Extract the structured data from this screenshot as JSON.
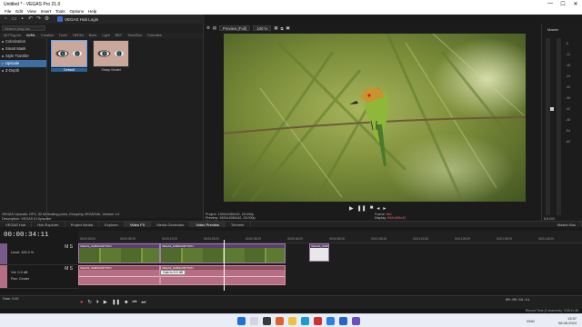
{
  "window": {
    "title": "Untitled * - VEGAS Pro 21.0",
    "controls": [
      "—",
      "☐",
      "✕"
    ]
  },
  "menu": [
    "File",
    "Edit",
    "View",
    "Insert",
    "Tools",
    "Options",
    "Help"
  ],
  "toolbar": {
    "hub_label": "VEGAS Hub Login"
  },
  "fx": {
    "search_placeholder": "Search plug-ins",
    "tabs": [
      "All Plug-ins",
      "AI/ML",
      "Creative",
      "Domi",
      "HitFilm",
      "Boris",
      "Light",
      "BBT",
      "Time/Blur",
      "Favorites"
    ],
    "active_tab": "AI/ML",
    "tree": [
      "Colorization",
      "Smart Mask",
      "Style Transfer",
      "Upscale",
      "Z-Depth"
    ],
    "selected_tree_index": 3,
    "thumbs": [
      {
        "label": "Default",
        "selected": true
      },
      {
        "label": "Sharp Model",
        "selected": false
      }
    ],
    "description_line1": "VEGAS Upscale: OFX, 32 bit floating point, Grouping VEGAS\\AI, Version 1.0",
    "description_line2": "Description: VEGAS AI Upscaler"
  },
  "dock_tabs": [
    "VEGAS Hub",
    "Hub Explorer",
    "Project Media",
    "Explorer",
    "Video FX",
    "Media Generator",
    "Video Preview",
    "Trimmer",
    "Master Bus"
  ],
  "dock_active": [
    "Video FX",
    "Video Preview"
  ],
  "preview": {
    "quality": "Preview (Full)",
    "zoom": "100 %",
    "project_info": "Project:  1920x1080x32, 25.000p",
    "preview_info": "Preview:  1920x1080x32, 25.000p",
    "display_info": "Video Preview",
    "frame_label": "Frame:",
    "frame_value": "861",
    "display_label": "Display:",
    "display_value": "692x389x32"
  },
  "meters": {
    "title": "Master",
    "scale": [
      "-6",
      "-12",
      "-18",
      "-24",
      "-30",
      "-36",
      "-42",
      "-48",
      "-54",
      "-60"
    ],
    "left_value": "-Inf.",
    "right_value": "-Inf.",
    "level_left": "0.0",
    "level_right": "0.0"
  },
  "timeline": {
    "timecode": "00:00:34:11",
    "ruler_marks": [
      "00:00:00:00",
      "00:00:09:29",
      "00:00:19:29",
      "00:00:29:29",
      "00:00:39:29",
      "00:00:49:29",
      "00:00:59:28",
      "00:01:09:28",
      "00:01:19:28",
      "00:01:29:29",
      "00:01:39:29",
      "00:01:49:29"
    ],
    "video_track": {
      "number": "1",
      "level": "Level: 100.0 %"
    },
    "audio_track": {
      "number": "2",
      "vol": "Vol:",
      "vol_value": "0.0 dB",
      "pan": "Pan:",
      "pan_value": "Center"
    },
    "clip_labels": [
      "VEGAS_SUBSCRIPTION",
      "VEGAS_SUBSCRIPTION",
      "VEGAS_SUBSCRIPTION"
    ],
    "tooltip": "Gain is 0.0 dB",
    "rate": "Rate: 0.00",
    "end_timecode": "00:00:34:11",
    "record_time": "Record Time (2 channels): 9:38:11:48"
  },
  "taskbar": {
    "lang": "ENG",
    "time": "13:57",
    "date": "06.06.2024"
  }
}
